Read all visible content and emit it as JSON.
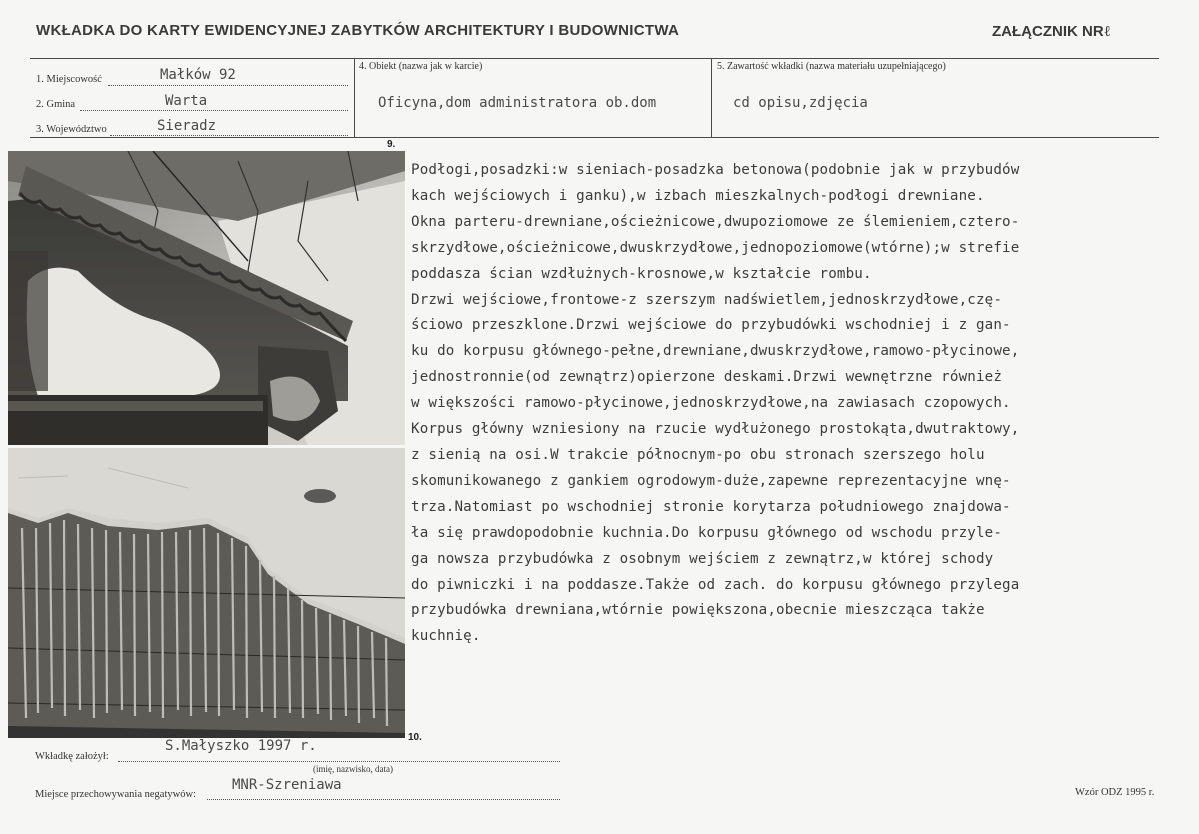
{
  "header": {
    "title": "WKŁADKA DO KARTY EWIDENCYJNEJ ZABYTKÓW ARCHITEKTURY I BUDOWNICTWA",
    "attachment": "ZAŁĄCZNIK NR",
    "attachment_no": "ℓ"
  },
  "fields": {
    "miejscowosc_label": "1. Miejscowość",
    "miejscowosc_value": "Małków 92",
    "gmina_label": "2. Gmina",
    "gmina_value": "Warta",
    "wojewodztwo_label": "3. Województwo",
    "wojewodztwo_value": "Sieradz",
    "obiekt_label": "4. Obiekt  (nazwa jak w karcie)",
    "obiekt_value": "Oficyna,dom administratora ob.dom",
    "zawartosc_label": "5. Zawartość wkładki  (nazwa materiału uzupełniającego)",
    "zawartosc_value": "cd opisu,zdjęcia"
  },
  "photos": {
    "top_number": "9.",
    "bottom_number": "10."
  },
  "body_lines": [
    "Podłogi,posadzki:w sieniach-posadzka betonowa(podobnie jak w przybudów",
    "kach wejściowych i ganku),w izbach mieszkalnych-podłogi drewniane.",
    "Okna parteru-drewniane,ościeżnicowe,dwupoziomowe ze ślemieniem,cztero-",
    "skrzydłowe,ościeżnicowe,dwuskrzydłowe,jednopoziomowe(wtórne);w strefie",
    "poddasza ścian wzdłużnych-krosnowe,w kształcie rombu.",
    "Drzwi wejściowe,frontowe-z szerszym nadświetlem,jednoskrzydłowe,czę-",
    "ściowo przeszklone.Drzwi wejściowe do przybudówki wschodniej i z gan-",
    "ku do korpusu głównego-pełne,drewniane,dwuskrzydłowe,ramowo-płycinowe,",
    "jednostronnie(od zewnątrz)opierzone deskami.Drzwi wewnętrzne również",
    "w większości ramowo-płycinowe,jednoskrzydłowe,na zawiasach czopowych.",
    "Korpus główny wzniesiony na rzucie wydłużonego prostokąta,dwutraktowy,",
    "z sienią na osi.W trakcie północnym-po obu stronach szerszego holu",
    "skomunikowanego z gankiem ogrodowym-duże,zapewne reprezentacyjne wnę-",
    "trza.Natomiast po wschodniej stronie korytarza południowego znajdowa-",
    "ła się prawdopodobnie kuchnia.Do korpusu głównego od wschodu przyle-",
    "ga nowsza przybudówka z osobnym wejściem z zewnątrz,w której schody",
    "do piwniczki i na poddasze.Także od zach. do korpusu głównego przylega",
    "przybudówka drewniana,wtórnie powiększona,obecnie mieszcząca także",
    "kuchnię."
  ],
  "footer": {
    "founder_label": "Wkładkę założył:",
    "founder_value": "S.Małyszko 1997 r.",
    "founder_hint": "(imię, nazwisko, data)",
    "storage_label": "Miejsce przechowywania negatywów:",
    "storage_value": "MNR-Szreniawa",
    "form_id": "Wzór ODZ 1995 r."
  }
}
